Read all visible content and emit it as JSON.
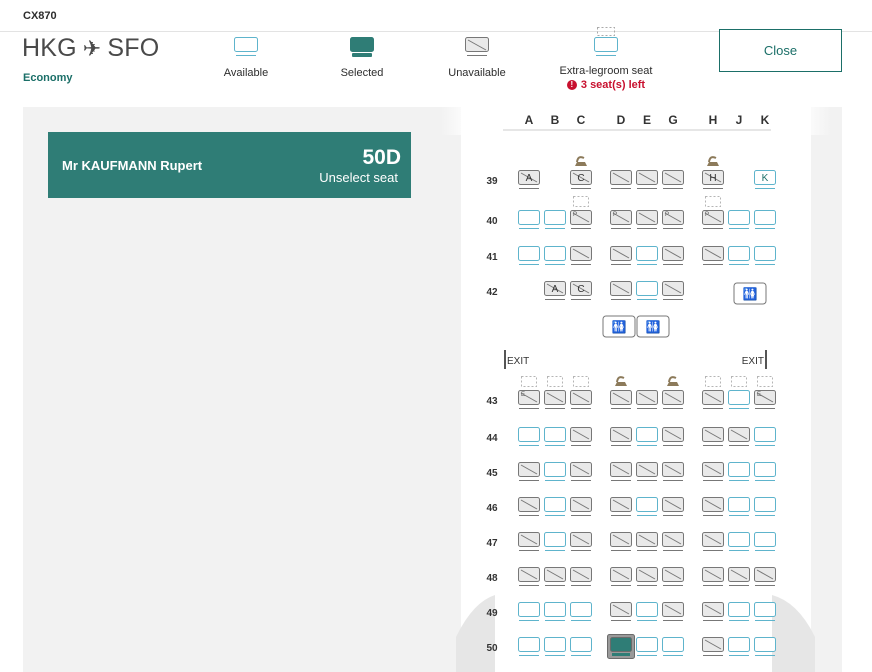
{
  "header": {
    "flight_number": "CX870",
    "origin": "HKG",
    "destination": "SFO",
    "cabin": "Economy",
    "close_label": "Close"
  },
  "legend": {
    "available": "Available",
    "selected": "Selected",
    "unavailable": "Unavailable",
    "extra_legroom": "Extra-legroom seat",
    "extra_legroom_left": "3 seat(s) left"
  },
  "passenger": {
    "name": "Mr KAUFMANN Rupert",
    "seat": "50D",
    "unselect_label": "Unselect seat"
  },
  "seatmap": {
    "columns": [
      "A",
      "B",
      "C",
      "D",
      "E",
      "G",
      "H",
      "J",
      "K"
    ],
    "exit_label": "EXIT",
    "rows": [
      {
        "row": "39",
        "seats": {
          "A": "unavailable",
          "B": "none",
          "C": "unavailable",
          "D": "unavailable",
          "E": "unavailable",
          "G": "unavailable",
          "H": "unavailable",
          "J": "none",
          "K": "available"
        },
        "marks": {
          "A": "A",
          "C": "C",
          "H": "H",
          "K": "K"
        },
        "bassinet": [
          "C",
          "H"
        ]
      },
      {
        "row": "40",
        "seats": {
          "A": "available",
          "B": "available",
          "C": "unavailable",
          "D": "unavailable",
          "E": "unavailable",
          "G": "unavailable",
          "H": "unavailable",
          "J": "available",
          "K": "available"
        },
        "marks": {
          "C": "P",
          "D": "P",
          "G": "P",
          "H": "P"
        },
        "legroom": [
          "C",
          "H"
        ]
      },
      {
        "row": "41",
        "seats": {
          "A": "available",
          "B": "available",
          "C": "unavailable",
          "D": "unavailable",
          "E": "available",
          "G": "unavailable",
          "H": "unavailable",
          "J": "available",
          "K": "available"
        }
      },
      {
        "row": "42",
        "seats": {
          "A": "none",
          "B": "unavailable",
          "C": "unavailable",
          "D": "unavailable",
          "E": "available",
          "G": "unavailable",
          "H": "none",
          "J": "none",
          "K": "none"
        },
        "marks": {
          "B": "A",
          "C": "C"
        }
      },
      {
        "row": "43",
        "seats": {
          "A": "unavailable",
          "B": "unavailable",
          "C": "unavailable",
          "D": "unavailable",
          "E": "unavailable",
          "G": "unavailable",
          "H": "unavailable",
          "J": "available",
          "K": "unavailable"
        },
        "marks": {
          "A": "E",
          "K": "E"
        },
        "legroom": [
          "A",
          "B",
          "C",
          "H",
          "J",
          "K"
        ],
        "bassinet": [
          "D",
          "G"
        ]
      },
      {
        "row": "44",
        "seats": {
          "A": "available",
          "B": "available",
          "C": "unavailable",
          "D": "unavailable",
          "E": "available",
          "G": "unavailable",
          "H": "unavailable",
          "J": "unavailable",
          "K": "available"
        }
      },
      {
        "row": "45",
        "seats": {
          "A": "unavailable",
          "B": "available",
          "C": "unavailable",
          "D": "unavailable",
          "E": "unavailable",
          "G": "unavailable",
          "H": "unavailable",
          "J": "available",
          "K": "available"
        }
      },
      {
        "row": "46",
        "seats": {
          "A": "unavailable",
          "B": "available",
          "C": "unavailable",
          "D": "unavailable",
          "E": "available",
          "G": "unavailable",
          "H": "unavailable",
          "J": "available",
          "K": "available"
        }
      },
      {
        "row": "47",
        "seats": {
          "A": "unavailable",
          "B": "available",
          "C": "unavailable",
          "D": "unavailable",
          "E": "unavailable",
          "G": "unavailable",
          "H": "unavailable",
          "J": "available",
          "K": "available"
        }
      },
      {
        "row": "48",
        "seats": {
          "A": "unavailable",
          "B": "unavailable",
          "C": "unavailable",
          "D": "unavailable",
          "E": "unavailable",
          "G": "unavailable",
          "H": "unavailable",
          "J": "unavailable",
          "K": "unavailable"
        }
      },
      {
        "row": "49",
        "seats": {
          "A": "available",
          "B": "available",
          "C": "available",
          "D": "unavailable",
          "E": "available",
          "G": "unavailable",
          "H": "unavailable",
          "J": "available",
          "K": "available"
        }
      },
      {
        "row": "50",
        "seats": {
          "A": "available",
          "B": "available",
          "C": "available",
          "D": "selected",
          "E": "available",
          "G": "available",
          "H": "unavailable",
          "J": "available",
          "K": "available"
        }
      }
    ]
  },
  "colors": {
    "accent": "#1b6f68",
    "selected": "#2f7d76",
    "available_outline": "#5eb4cc",
    "unavailable_outline": "#777777",
    "alert": "#c8102e"
  }
}
